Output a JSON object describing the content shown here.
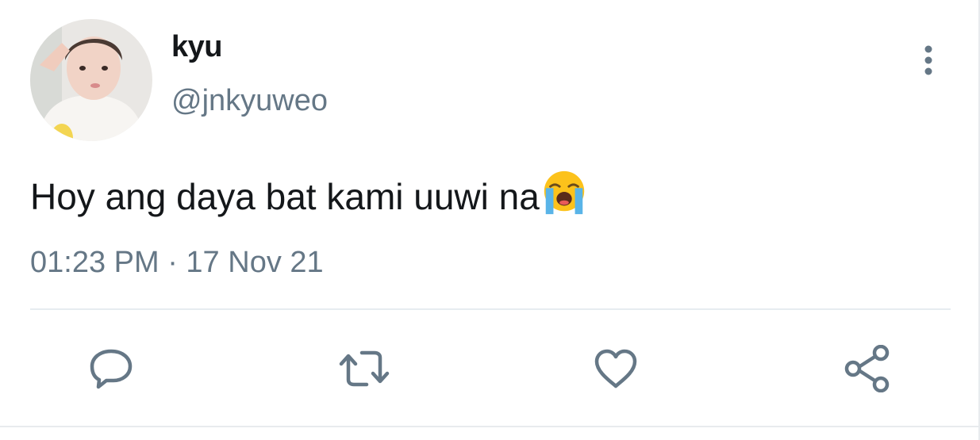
{
  "tweet": {
    "display_name": "kyu",
    "handle": "@jnkyuweo",
    "text": "Hoy ang daya bat kami uuwi na",
    "emoji": "loudly-crying-face",
    "timestamp": "01:23 PM · 17 Nov 21"
  },
  "icons": {
    "more": "more-vertical-icon",
    "reply": "reply-icon",
    "retweet": "retweet-icon",
    "like": "heart-icon",
    "share": "share-icon"
  },
  "colors": {
    "text_primary": "#14171a",
    "text_secondary": "#657786",
    "icon": "#657786",
    "divider": "#e6ecf0"
  }
}
